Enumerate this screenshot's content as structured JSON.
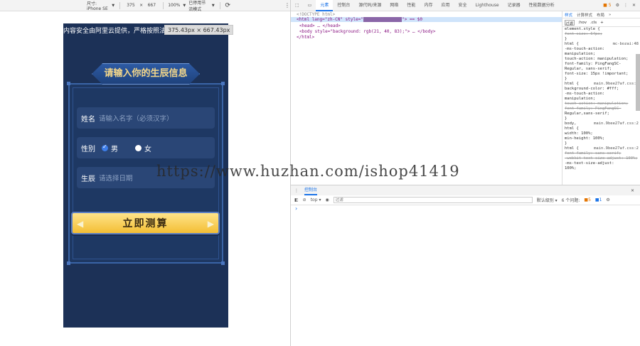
{
  "device_toolbar": {
    "device": "尺寸: iPhone SE",
    "width": "375",
    "times": "×",
    "height": "667",
    "zoom": "100%",
    "throttle": "已停用节流模式"
  },
  "phone": {
    "notice": "内容安全由阿里云提供，严格按照法律",
    "size_tooltip": "375.43px × 667.43px",
    "title": "请输入你的生辰信息",
    "form": {
      "name_label": "姓名",
      "name_placeholder": "请输入名字（必须汉字）",
      "gender_label": "性别",
      "gender_options": [
        "男",
        "女"
      ],
      "gender_selected": "男",
      "birth_label": "生辰",
      "birth_placeholder": "请选择日期"
    },
    "submit_label": "立即测算"
  },
  "watermark": "https://www.huzhan.com/ishop41419",
  "devtools": {
    "tabs": [
      "元素",
      "控制台",
      "源代码/来源",
      "网络",
      "性能",
      "内存",
      "应用",
      "安全",
      "Lighthouse",
      "记录器",
      "性能数据分析"
    ],
    "active_tab": "元素",
    "issues_badge": "5",
    "elements": [
      "<!DOCTYPE html>",
      "<html lang=\"zh-CN\" style=\"",
      "<head> … </head>",
      "<body style=\"background: rgb(21, 40, 83);\"> … </body>",
      "</html>"
    ],
    "styles_tabs": [
      "样式",
      "计算样式",
      "布局",
      "»"
    ],
    "styles_filter": "过滤",
    "styles_toggles": [
      ":hov",
      ".cls",
      "+"
    ],
    "styles_rules": [
      {
        "text": "element.style {",
        "strike": false
      },
      {
        "text": "font-size: 64px;",
        "strike": true
      },
      {
        "text": "}",
        "strike": false
      },
      {
        "text": "html {",
        "src": "mc-bozai:48",
        "strike": false
      },
      {
        "text": "-ms-touch-action:",
        "strike": false
      },
      {
        "text": "manipulation;",
        "strike": false
      },
      {
        "text": "touch-action: manipulation;",
        "strike": false
      },
      {
        "text": "font-family: PingFangSC-",
        "strike": false
      },
      {
        "text": "Regular, sans-serif;",
        "strike": false
      },
      {
        "text": "font-size: 15px !important;",
        "strike": false
      },
      {
        "text": "}",
        "strike": false
      },
      {
        "text": "html {",
        "src": "main.9bee27af.css:2",
        "strike": false
      },
      {
        "text": "background-color: #fff;",
        "strike": false
      },
      {
        "text": "-ms-touch-action:",
        "strike": false
      },
      {
        "text": "manipulation;",
        "strike": false
      },
      {
        "text": "touch-action: manipulation;",
        "strike": true
      },
      {
        "text": "font-family: PingFangSC-",
        "strike": true
      },
      {
        "text": "Regular,sans-serif;",
        "strike": false
      },
      {
        "text": "}",
        "strike": false
      },
      {
        "text": "body,",
        "src": "main.9bee27af.css:2",
        "strike": false
      },
      {
        "text": "html {",
        "strike": false
      },
      {
        "text": "width: 100%;",
        "strike": false
      },
      {
        "text": "min-height: 100%;",
        "strike": false
      },
      {
        "text": "}",
        "strike": false
      },
      {
        "text": "html {",
        "src": "main.9bee27af.css:2",
        "strike": false
      },
      {
        "text": "font-family: sans-serif;",
        "strike": true
      },
      {
        "text": "-webkit-text-size-adjust: 100%;",
        "strike": true
      },
      {
        "text": "-ms-text-size-adjust:",
        "strike": false
      },
      {
        "text": "100%;",
        "strike": false
      }
    ],
    "console_tab": "控制台",
    "console_context": "top",
    "console_filter": "过滤",
    "console_level": "默认级别",
    "console_issues": "6 个问题:",
    "console_issue_counts": [
      "5",
      "1"
    ]
  }
}
